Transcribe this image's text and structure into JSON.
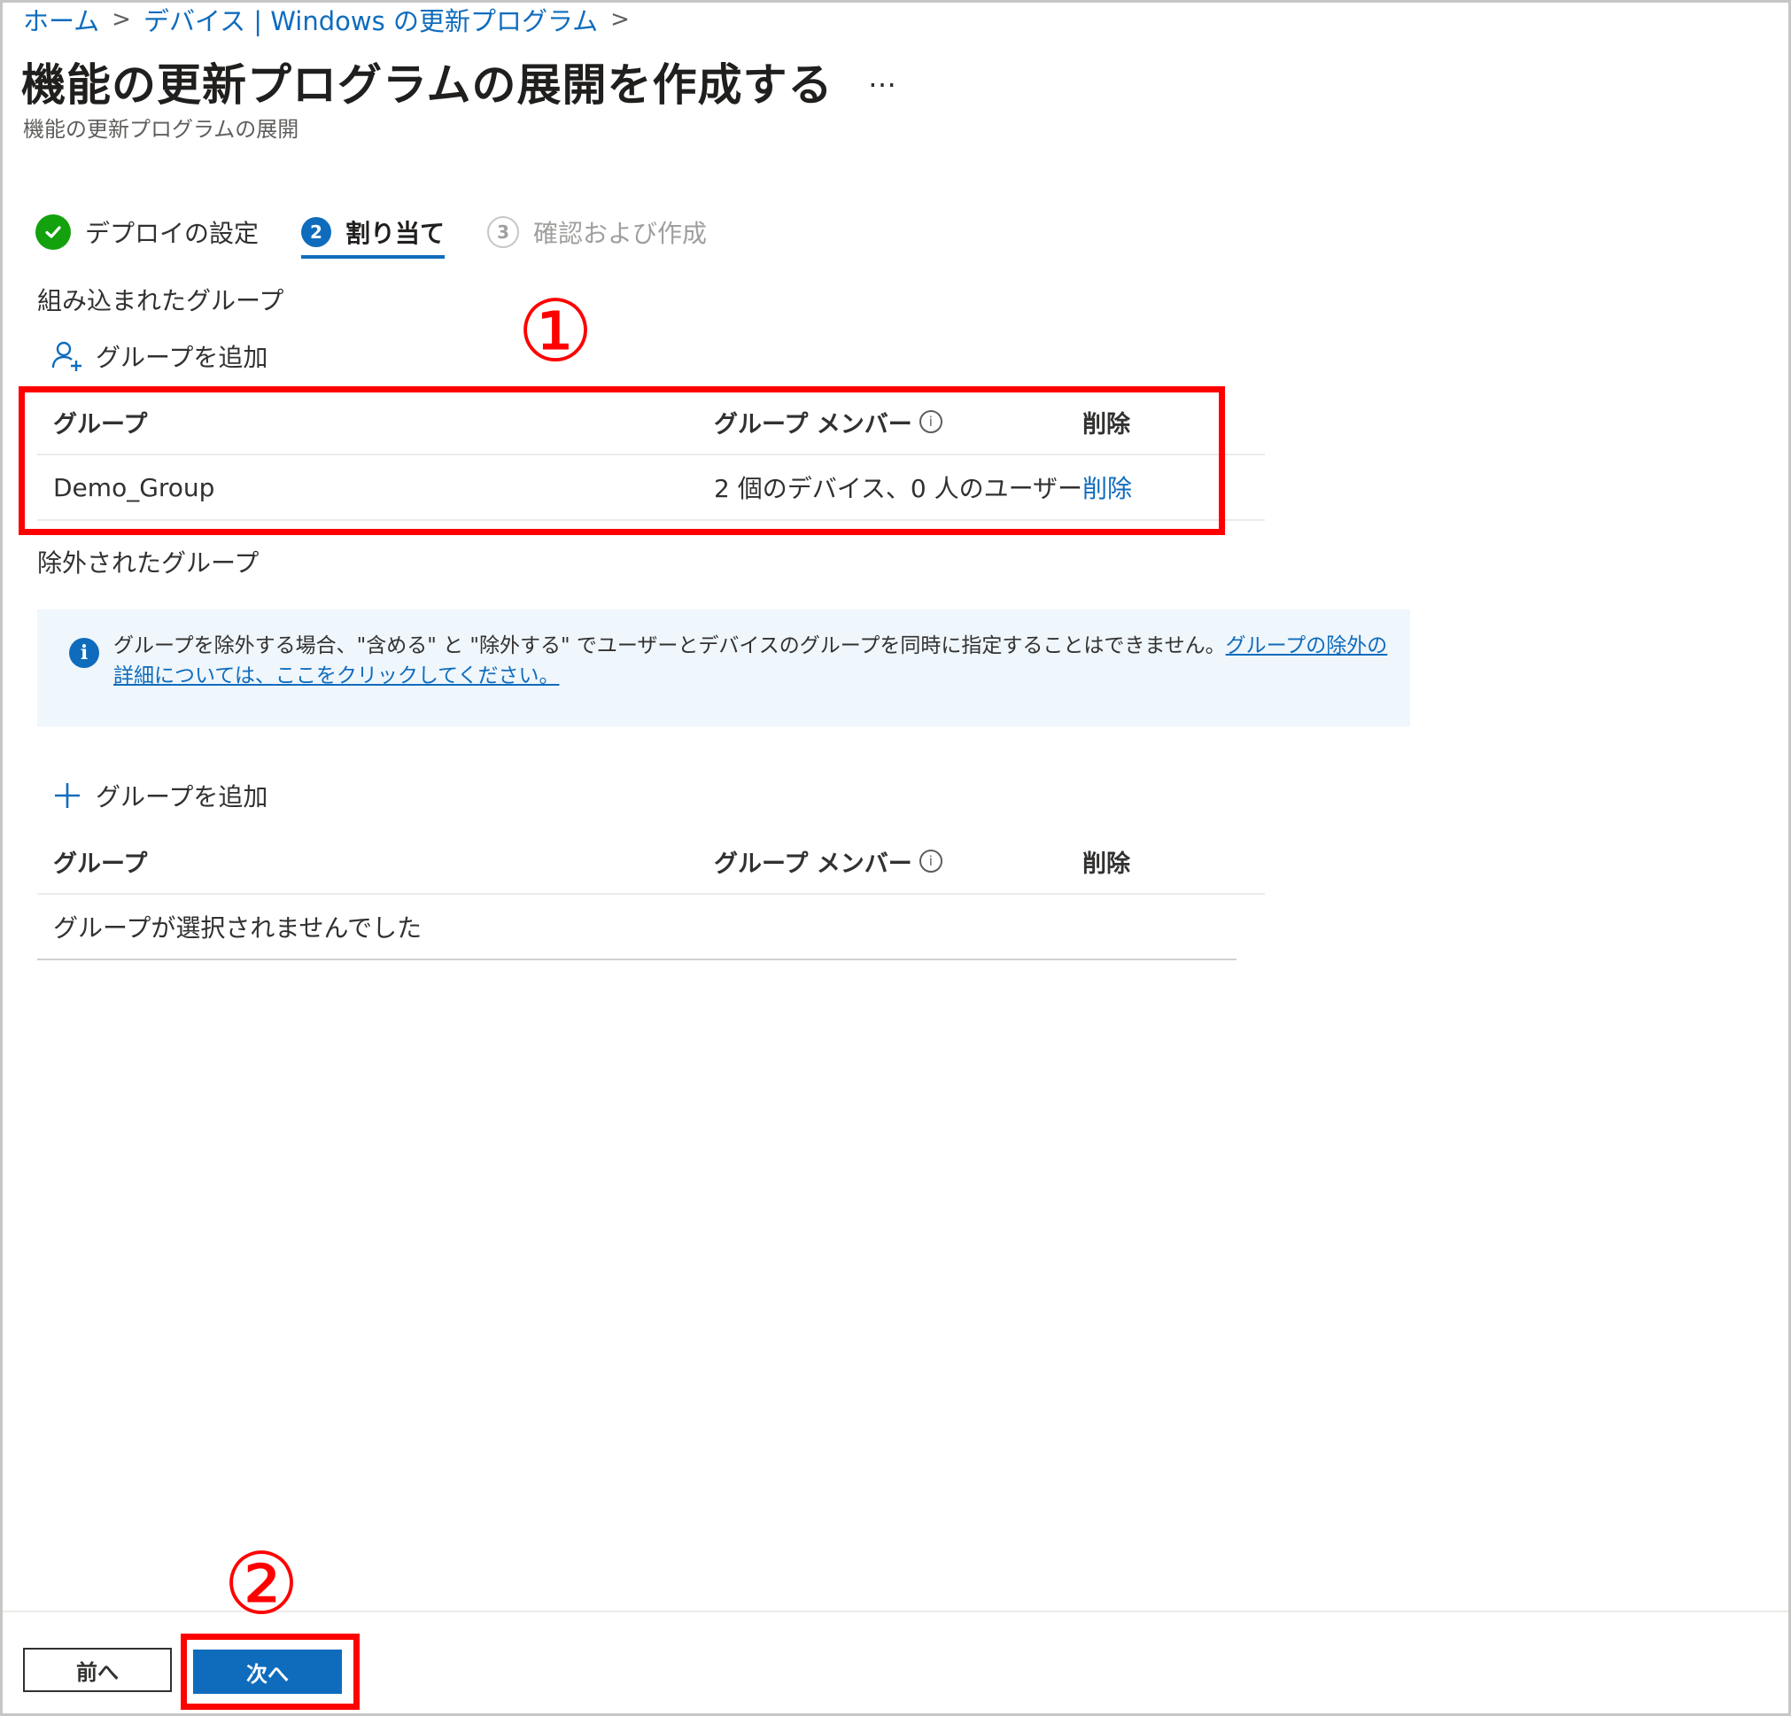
{
  "breadcrumb": {
    "home": "ホーム",
    "devices": "デバイス | Windows の更新プログラム",
    "separator": ">"
  },
  "header": {
    "title": "機能の更新プログラムの展開を作成する",
    "more": "…",
    "subtitle": "機能の更新プログラムの展開"
  },
  "steps": [
    {
      "number": "",
      "label": "デプロイの設定",
      "state": "done"
    },
    {
      "number": "2",
      "label": "割り当て",
      "state": "active"
    },
    {
      "number": "3",
      "label": "確認および作成",
      "state": "upcoming"
    }
  ],
  "included": {
    "section_title": "組み込まれたグループ",
    "add_label": "グループを追加",
    "columns": {
      "group": "グループ",
      "members": "グループ メンバー",
      "delete": "削除"
    },
    "rows": [
      {
        "group": "Demo_Group",
        "members": "2 個のデバイス、0 人のユーザー",
        "delete": "削除"
      }
    ]
  },
  "excluded": {
    "section_title": "除外されたグループ",
    "info_message": "グループを除外する場合、\"含める\" と \"除外する\" でユーザーとデバイスのグループを同時に指定することはできません。",
    "info_link": "グループの除外の詳細については、ここをクリックしてください。",
    "add_label": "グループを追加",
    "columns": {
      "group": "グループ",
      "members": "グループ メンバー",
      "delete": "削除"
    },
    "empty_text": "グループが選択されませんでした"
  },
  "annotations": {
    "first": "①",
    "second": "②"
  },
  "footer": {
    "prev": "前へ",
    "next": "次へ"
  },
  "colors": {
    "accent": "#0f6cbd",
    "success": "#13a10e",
    "annotation": "#ff0000",
    "info_bg": "#eff6fc"
  }
}
